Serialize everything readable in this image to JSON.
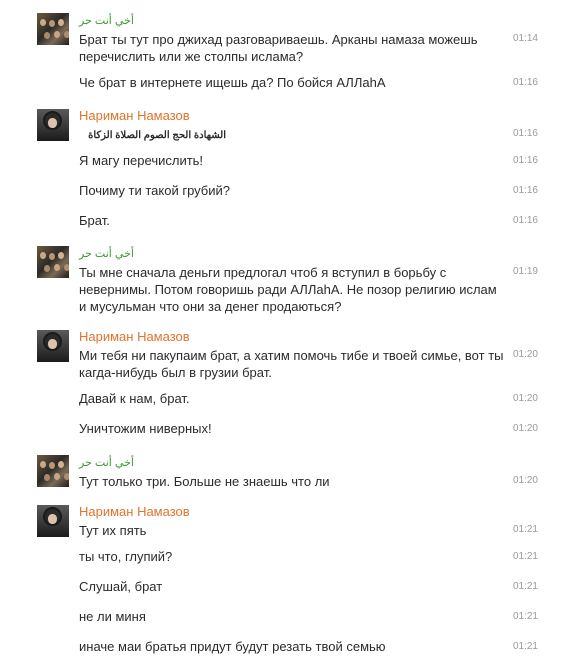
{
  "conversation": {
    "author_green": "أخي أنت حر",
    "author_orange": "Нариман Намазов",
    "messages": [
      {
        "text": "Брат ты тут про джихад разговариваешь. Арканы намаза можешь",
        "time": "01:14"
      },
      {
        "text": "перечислить или же столпы ислама?",
        "time": ""
      },
      {
        "text": "Че брат в интернете ищешь да? По бойся АЛЛahА",
        "time": "01:16"
      },
      {
        "text": "الشهادة    الحج الصوم   الصلاة  الزكاة",
        "time": "01:16"
      },
      {
        "text": "Я магу перечислить!",
        "time": "01:16"
      },
      {
        "text": "Почиму ти такой грубий?",
        "time": "01:16"
      },
      {
        "text": "Брат.",
        "time": "01:16"
      },
      {
        "text": "Ты мне сначала деньги предлогал чтоб я вступил в борьбу с",
        "time": "01:19"
      },
      {
        "text": "невернимы. Потом говоришь ради АЛЛahА.  Не позор религию ислам",
        "time": ""
      },
      {
        "text": "и мусульман что они за денег продаються?",
        "time": ""
      },
      {
        "text": "Ми тебя ни пакупаим брат, а хатим помочь тибе и твоей симье, вот ты",
        "time": "01:20"
      },
      {
        "text": "кагда-нибудь был в грузии брат.",
        "time": ""
      },
      {
        "text": "Давай к нам, брат.",
        "time": "01:20"
      },
      {
        "text": "Уничтожим ниверных!",
        "time": "01:20"
      },
      {
        "text": "Тут только три. Больше не знаешь что ли",
        "time": "01:20"
      },
      {
        "text": "Тут их пять",
        "time": "01:21"
      },
      {
        "text": "ты что, глупий?",
        "time": "01:21"
      },
      {
        "text": "Слушай, брат",
        "time": "01:21"
      },
      {
        "text": "не ли миня",
        "time": "01:21"
      },
      {
        "text": "иначе маи братья придут будут резать твой семью",
        "time": "01:21"
      }
    ]
  }
}
